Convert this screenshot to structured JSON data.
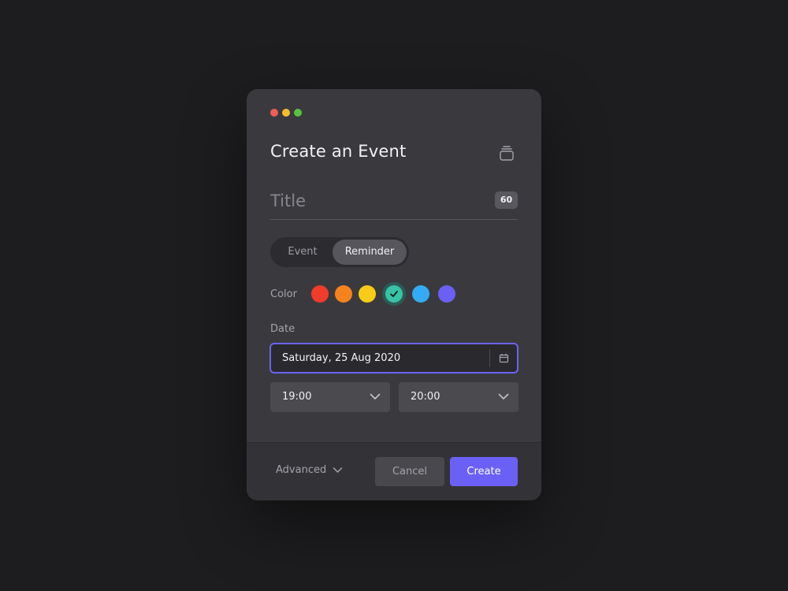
{
  "dialog": {
    "window_controls": [
      {
        "name": "close",
        "color": "#ee5f57"
      },
      {
        "name": "minimize",
        "color": "#f3bd2f"
      },
      {
        "name": "maximize",
        "color": "#58c240"
      }
    ],
    "title": "Create an Event",
    "header_icon": "stack-icon"
  },
  "title_field": {
    "placeholder": "Title",
    "value": "",
    "char_limit": "60"
  },
  "type_toggle": {
    "options": [
      "Event",
      "Reminder"
    ],
    "selected": "Reminder"
  },
  "color_picker": {
    "label": "Color",
    "swatches": [
      {
        "name": "red",
        "hex": "#f23b2b"
      },
      {
        "name": "orange",
        "hex": "#f7821b"
      },
      {
        "name": "yellow",
        "hex": "#f7cb16"
      },
      {
        "name": "teal",
        "hex": "#37c3a6"
      },
      {
        "name": "blue",
        "hex": "#33abf6"
      },
      {
        "name": "purple",
        "hex": "#6a60f6"
      }
    ],
    "selected": "teal"
  },
  "date": {
    "label": "Date",
    "value": "Saturday, 25 Aug 2020",
    "icon": "calendar-icon"
  },
  "time": {
    "start": "19:00",
    "end": "20:00"
  },
  "footer": {
    "advanced_label": "Advanced",
    "cancel_label": "Cancel",
    "create_label": "Create"
  },
  "colors": {
    "accent": "#6a60f6",
    "background": "#1d1d1f",
    "dialog": "#3a3a3e"
  }
}
